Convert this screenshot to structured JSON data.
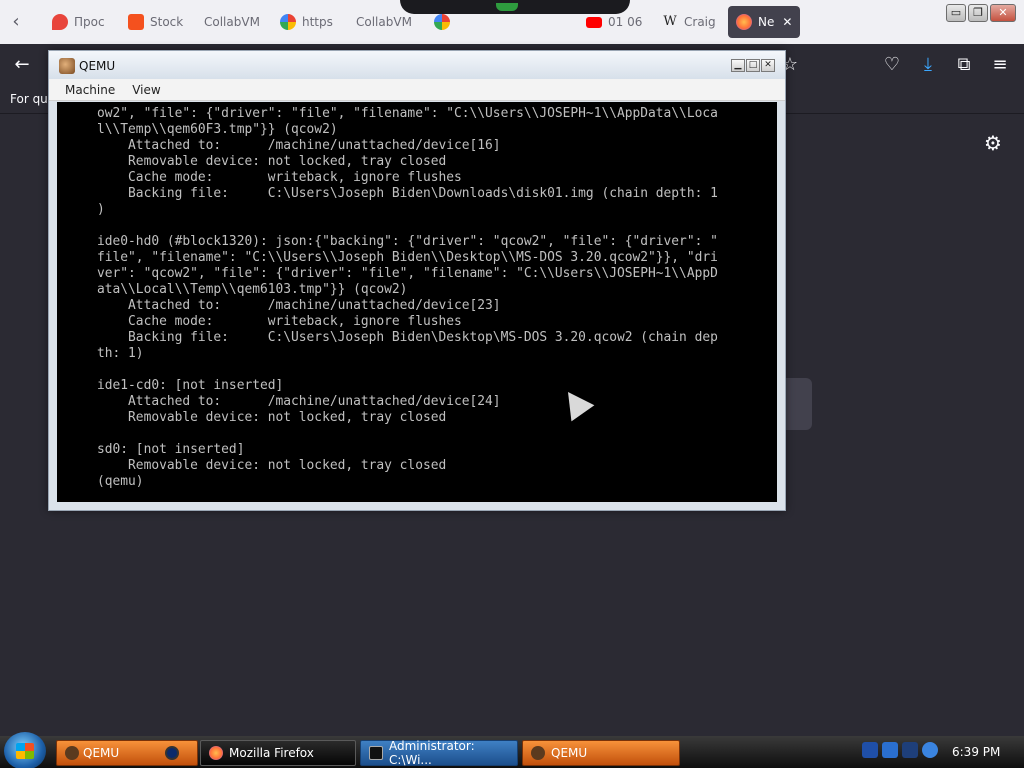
{
  "browser": {
    "tabs": [
      {
        "label": "Прос",
        "favicon_color": "#e8453c"
      },
      {
        "label": "Stock",
        "favicon_color": "#f4511e"
      },
      {
        "label": "CollabVM",
        "favicon_color": ""
      },
      {
        "label": "https",
        "favicon_color": "#4285f4"
      },
      {
        "label": "CollabVM",
        "favicon_color": ""
      },
      {
        "label": "",
        "favicon_color": "#4285f4"
      },
      {
        "label": "01 06",
        "favicon_color": "#ff0000"
      },
      {
        "label": "Craig",
        "favicon_color": "#e8e8e8"
      },
      {
        "label": "Ne",
        "favicon_color": "#ff7139",
        "active": true
      }
    ],
    "tab_close_glyph": "✕",
    "bookmarks_text": "For qui",
    "window_controls": {
      "minimize": "▭",
      "restore": "❐",
      "close": "✕"
    },
    "colors": {
      "chrome_dark": "#2b2a33",
      "tabbar": "#f0f0f4"
    }
  },
  "qemu": {
    "title": "QEMU",
    "menu": [
      "Machine",
      "View"
    ],
    "console_lines": [
      "ow2\", \"file\": {\"driver\": \"file\", \"filename\": \"C:\\\\Users\\\\JOSEPH~1\\\\AppData\\\\Loca",
      "l\\\\Temp\\\\qem60F3.tmp\"}} (qcow2)",
      "    Attached to:      /machine/unattached/device[16]",
      "    Removable device: not locked, tray closed",
      "    Cache mode:       writeback, ignore flushes",
      "    Backing file:     C:\\Users\\Joseph Biden\\Downloads\\disk01.img (chain depth: 1",
      ")",
      "",
      "ide0-hd0 (#block1320): json:{\"backing\": {\"driver\": \"qcow2\", \"file\": {\"driver\": \"",
      "file\", \"filename\": \"C:\\\\Users\\\\Joseph Biden\\\\Desktop\\\\MS-DOS 3.20.qcow2\"}}, \"dri",
      "ver\": \"qcow2\", \"file\": {\"driver\": \"file\", \"filename\": \"C:\\\\Users\\\\JOSEPH~1\\\\AppD",
      "ata\\\\Local\\\\Temp\\\\qem6103.tmp\"}} (qcow2)",
      "    Attached to:      /machine/unattached/device[23]",
      "    Cache mode:       writeback, ignore flushes",
      "    Backing file:     C:\\Users\\Joseph Biden\\Desktop\\MS-DOS 3.20.qcow2 (chain dep",
      "th: 1)",
      "",
      "ide1-cd0: [not inserted]",
      "    Attached to:      /machine/unattached/device[24]",
      "    Removable device: not locked, tray closed",
      "",
      "sd0: [not inserted]",
      "    Removable device: not locked, tray closed",
      "(qemu)"
    ]
  },
  "taskbar": {
    "group_label": "QEMU",
    "items": [
      {
        "label": "Mozilla Firefox"
      },
      {
        "label": "Administrator: C:\\Wi..."
      },
      {
        "label": "QEMU"
      }
    ],
    "clock": "6:39 PM"
  }
}
